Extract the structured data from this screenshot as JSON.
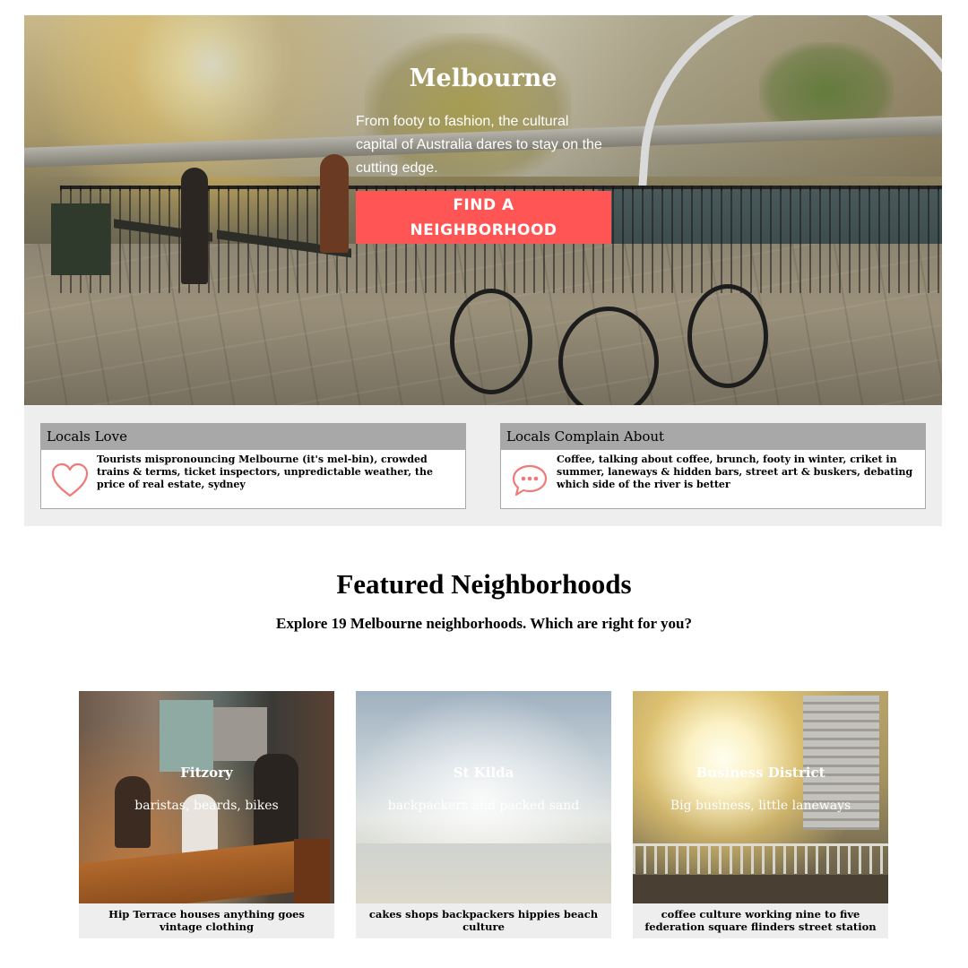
{
  "hero": {
    "title": "Melbourne",
    "subtitle": "From footy to fashion, the cultural capital of Australia dares to stay on the cutting edge.",
    "cta_label": "FIND A NEIGHBORHOOD",
    "accent_color": "#ff5555"
  },
  "locals": {
    "love": {
      "title": "Locals Love",
      "icon": "heart-icon",
      "text": "Tourists mispronouncing Melbourne (it's mel-bin), crowded trains & terms, ticket inspectors, unpredictable weather, the price of real estate, sydney"
    },
    "complain": {
      "title": "Locals Complain About",
      "icon": "speech-bubble-icon",
      "text": "Coffee, talking about coffee, brunch, footy in winter, criket in summer, laneways & hidden bars, street art & buskers, debating which side of the river is better"
    }
  },
  "featured": {
    "title": "Featured Neighborhoods",
    "subtitle": "Explore 19 Melbourne neighborhoods. Which are right for you?",
    "neighborhoods": [
      {
        "name": "Fitzory",
        "tagline": "baristas, beards, bikes",
        "caption": "Hip Terrace houses anything goes vintage clothing"
      },
      {
        "name": "St Kilda",
        "tagline": "backpackers and packed sand",
        "caption": "cakes shops backpackers hippies beach culture"
      },
      {
        "name": "Business District",
        "tagline": "Big business, little laneways",
        "caption": "coffee culture working nine to five federation square flinders street station"
      }
    ]
  }
}
